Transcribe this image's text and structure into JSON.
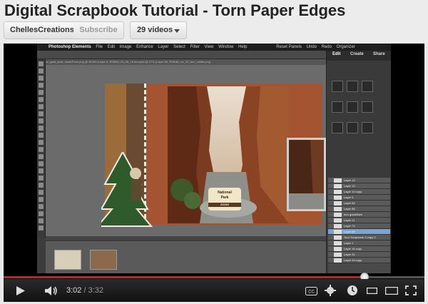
{
  "header": {
    "title": "Digital Scrapbook Tutorial - Torn Paper Edges",
    "channel": "ChellesCreations",
    "subscribe_label": "Subscribe",
    "videos_label": "29 videos"
  },
  "app": {
    "name": "Photoshop Elements",
    "menu": [
      "File",
      "Edit",
      "Image",
      "Enhance",
      "Layer",
      "Select",
      "Filter",
      "View",
      "Window",
      "Help"
    ],
    "menu_right": [
      "Reset Panels",
      "Undo",
      "Redo",
      "Organizer"
    ],
    "doc_tabs": "zz_grad_pear_madeFrom.png @ 36.8% (Layer 8, RGB/8)  |  Bl_08_19 torn.psd @ 27% (Layer 68, RGB/8)  |  zz_Z4_torn_whites.png",
    "panel_tabs": [
      "Edit",
      "Create",
      "Share"
    ],
    "layers": [
      "Layer 14",
      "Layer 13",
      "Layer 10 copy",
      "Layer 3",
      "Layer 84",
      "Layer 85",
      "torn guidelines",
      "Layer 11",
      "Layer 73",
      "Layer 68",
      "Your Scrapbook 3 copy 2",
      "Layer 1",
      "Layer 16 copy",
      "Layer 31",
      "Layer 49 copy"
    ]
  },
  "scrapbook": {
    "sign_line1": "National",
    "sign_line2": "Park",
    "sign_place": "ZIONS"
  },
  "player": {
    "current_time": "3:02",
    "duration": "3:32",
    "progress": 0.857,
    "accent": "#d41f1f"
  }
}
